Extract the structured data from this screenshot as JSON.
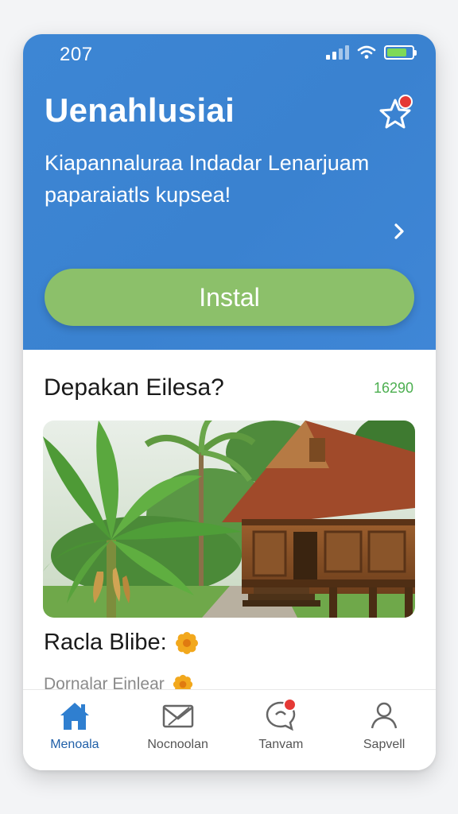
{
  "status_bar": {
    "time": "207",
    "battery_level": 0.8,
    "battery_color": "#7ed957"
  },
  "hero": {
    "title": "Uenahlusiai",
    "subtitle": "Kiapannaluraa Indadar Lenarjuam paparaiatls kupsea!",
    "install_label": "Instal",
    "background_color": "#3a82d0",
    "install_color": "#8cc06a"
  },
  "icons": {
    "favorite": "star-icon",
    "next": "chevron-right-icon"
  },
  "section": {
    "title": "Depakan Eilesa?",
    "count": "16290",
    "image_description": "banana-plant-and-wooden-house",
    "caption": "Racla Blibe:",
    "caption_sub": "Dornalar Einlear"
  },
  "bottom_nav": {
    "items": [
      {
        "label": "Menoala",
        "icon": "home-icon",
        "active": true
      },
      {
        "label": "Nocnoolan",
        "icon": "mail-icon",
        "active": false
      },
      {
        "label": "Tanvam",
        "icon": "chat-icon",
        "active": false
      },
      {
        "label": "Sapvell",
        "icon": "profile-icon",
        "active": false
      }
    ]
  }
}
